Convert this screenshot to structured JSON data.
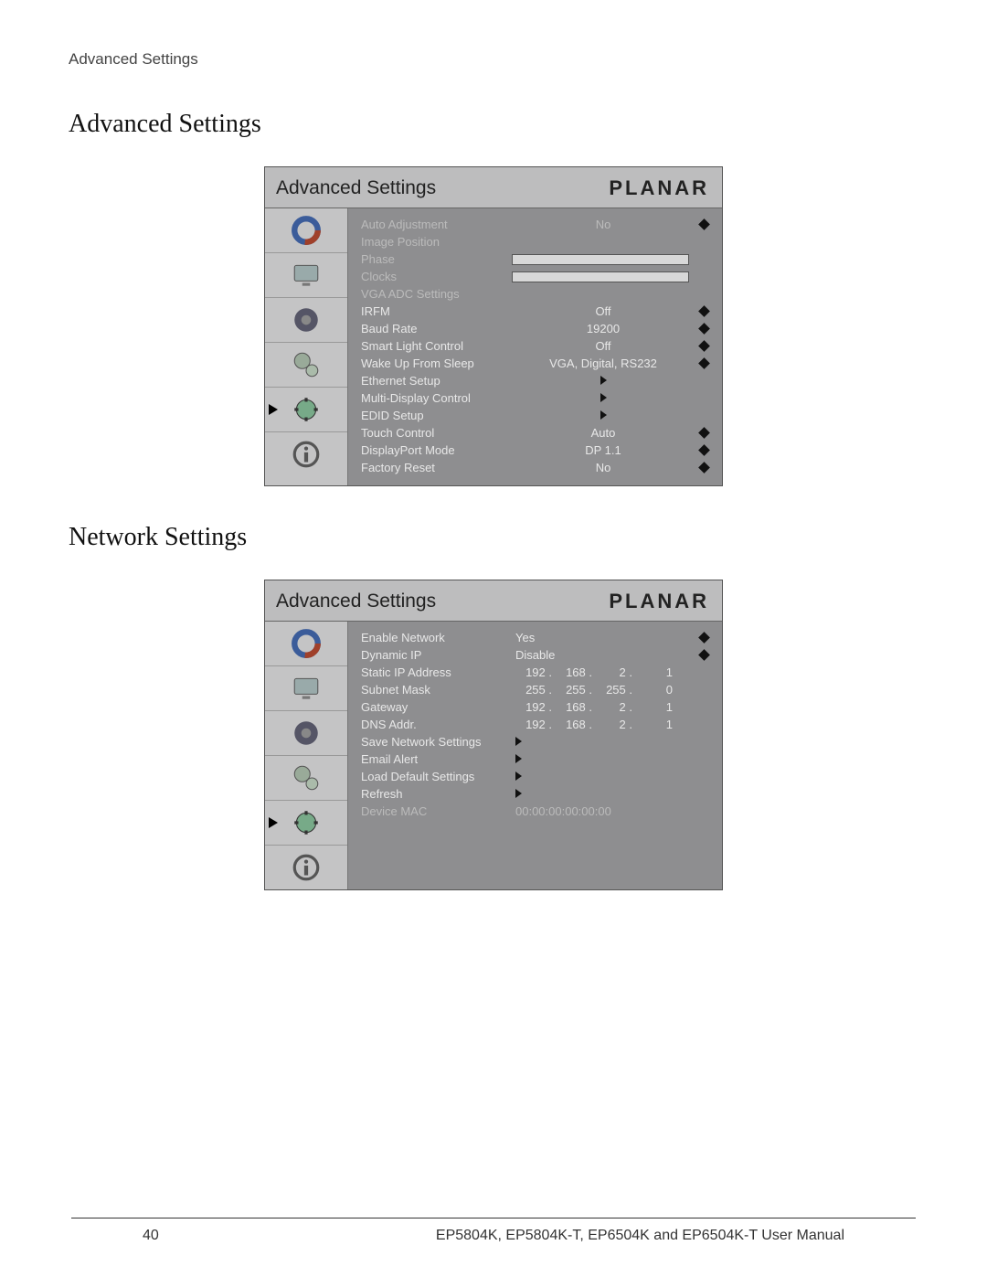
{
  "breadcrumb": "Advanced Settings",
  "section1": {
    "title": "Advanced Settings",
    "osd": {
      "title": "Advanced Settings",
      "brand": "PLANAR",
      "rows": [
        {
          "label": "Auto Adjustment",
          "value": "No",
          "disabled": true,
          "kind": "diamond"
        },
        {
          "label": "Image Position",
          "value": "",
          "disabled": true,
          "kind": "none"
        },
        {
          "label": "Phase",
          "value": "",
          "disabled": true,
          "kind": "slider"
        },
        {
          "label": "Clocks",
          "value": "",
          "disabled": true,
          "kind": "slider"
        },
        {
          "label": "VGA ADC Settings",
          "value": "",
          "disabled": true,
          "kind": "none"
        },
        {
          "label": "IRFM",
          "value": "Off",
          "kind": "diamond"
        },
        {
          "label": "Baud Rate",
          "value": "19200",
          "kind": "diamond"
        },
        {
          "label": "Smart Light Control",
          "value": "Off",
          "kind": "diamond"
        },
        {
          "label": "Wake Up From Sleep",
          "value": "VGA, Digital, RS232",
          "kind": "diamond"
        },
        {
          "label": "Ethernet Setup",
          "value": "",
          "kind": "arrow"
        },
        {
          "label": "Multi-Display Control",
          "value": "",
          "kind": "arrow"
        },
        {
          "label": "EDID Setup",
          "value": "",
          "kind": "arrow"
        },
        {
          "label": "Touch Control",
          "value": "Auto",
          "kind": "diamond"
        },
        {
          "label": "DisplayPort Mode",
          "value": "DP 1.1",
          "kind": "diamond"
        },
        {
          "label": "Factory Reset",
          "value": "No",
          "kind": "diamond"
        }
      ]
    }
  },
  "section2": {
    "title": "Network Settings",
    "osd": {
      "title": "Advanced Settings",
      "brand": "PLANAR",
      "rows": [
        {
          "label": "Enable Network",
          "valueLeft": "Yes",
          "kind": "diamond"
        },
        {
          "label": "Dynamic IP",
          "valueLeft": "Disable",
          "kind": "diamond"
        },
        {
          "label": "Static IP Address",
          "ip": [
            "192 .",
            "168 .",
            "2 .",
            "1"
          ],
          "kind": "none"
        },
        {
          "label": "Subnet Mask",
          "ip": [
            "255 .",
            "255 .",
            "255 .",
            "0"
          ],
          "kind": "none"
        },
        {
          "label": "Gateway",
          "ip": [
            "192 .",
            "168 .",
            "2 .",
            "1"
          ],
          "kind": "none"
        },
        {
          "label": "DNS Addr.",
          "ip": [
            "192 .",
            "168 .",
            "2 .",
            "1"
          ],
          "kind": "none"
        },
        {
          "label": "Save Network Settings",
          "valueLeft": "",
          "kind": "arrowLeft"
        },
        {
          "label": "Email Alert",
          "valueLeft": "",
          "kind": "arrowLeft"
        },
        {
          "label": "Load Default Settings",
          "valueLeft": "",
          "kind": "arrowLeft"
        },
        {
          "label": "Refresh",
          "valueLeft": "",
          "kind": "arrowLeft"
        },
        {
          "label": "Device MAC",
          "valueLeft": "00:00:00:00:00:00",
          "disabled": true,
          "kind": "none"
        }
      ]
    }
  },
  "footer": {
    "page": "40",
    "text": "EP5804K, EP5804K-T, EP6504K and EP6504K-T User Manual"
  }
}
